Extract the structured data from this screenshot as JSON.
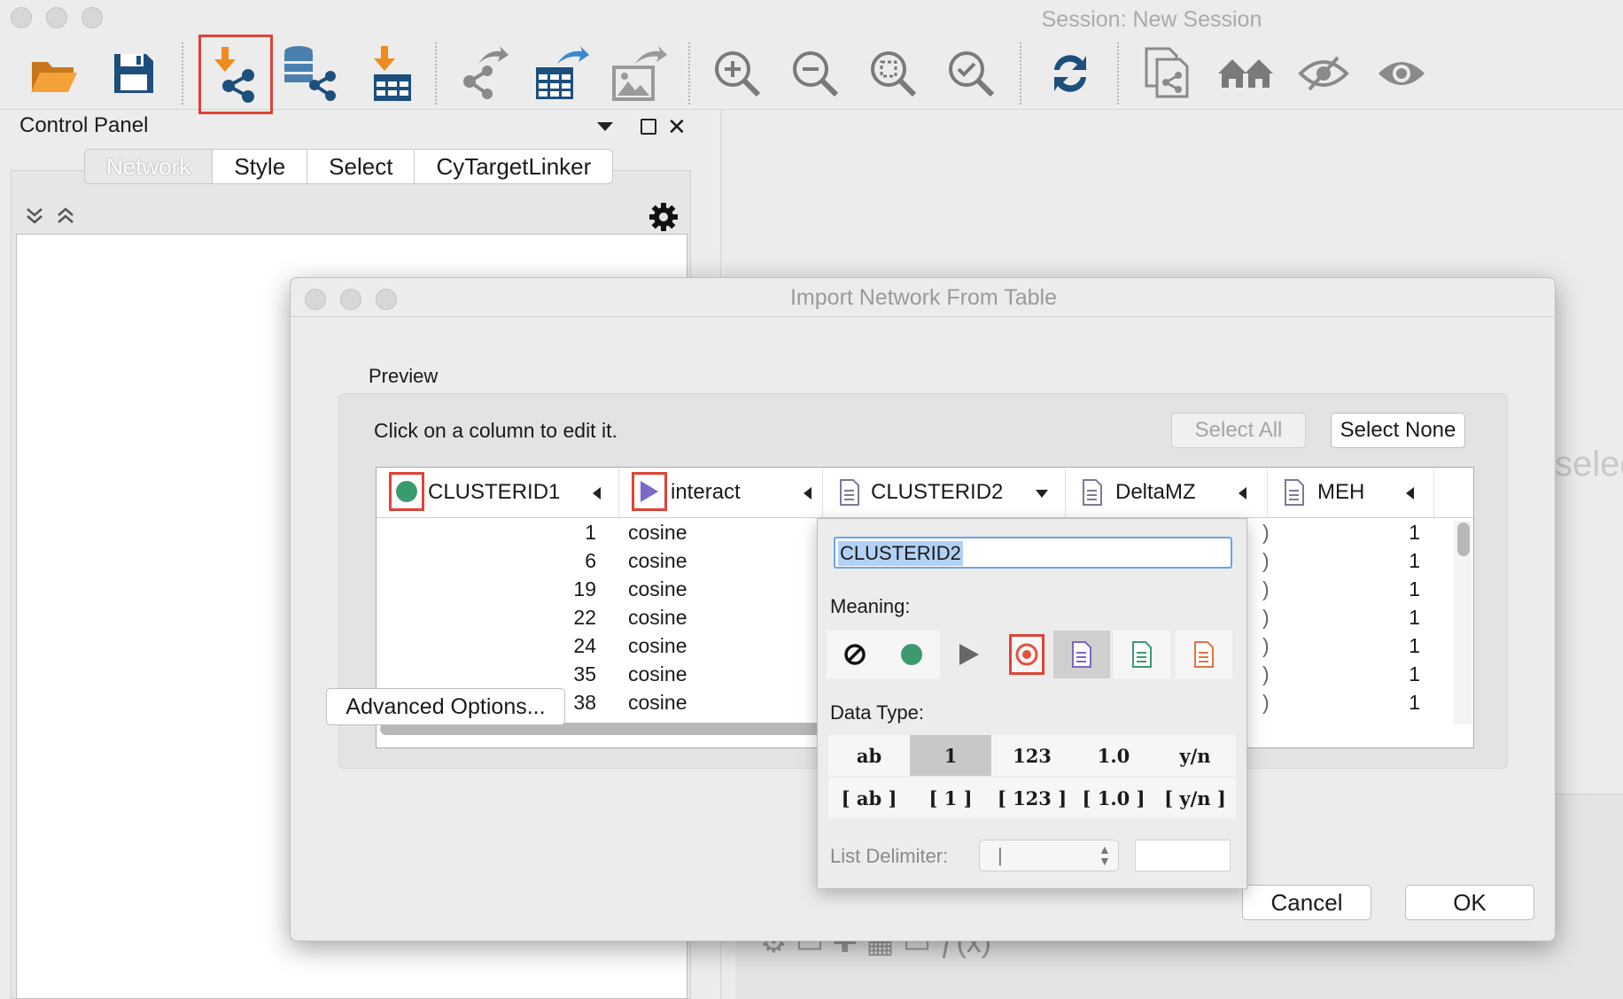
{
  "window": {
    "title": "Session: New Session"
  },
  "toolbar": {
    "icons": [
      "open-folder-icon",
      "save-icon",
      "import-network-from-file-icon",
      "import-network-from-database-icon",
      "import-table-icon",
      "export-network-icon",
      "export-table-icon",
      "export-image-icon",
      "zoom-in-icon",
      "zoom-out-icon",
      "zoom-fit-icon",
      "zoom-selected-icon",
      "refresh-icon",
      "new-network-from-selection-icon",
      "home-icon",
      "hide-icon",
      "show-icon"
    ]
  },
  "control_panel": {
    "title": "Control Panel",
    "tabs": [
      "Network",
      "Style",
      "Select",
      "CyTargetLinker"
    ]
  },
  "background": {
    "partial_text": "selec"
  },
  "dialog": {
    "title": "Import Network From Table",
    "preview_label": "Preview",
    "instruction": "Click on a column to edit it.",
    "select_all": "Select All",
    "select_none": "Select None",
    "advanced_options": "Advanced Options...",
    "cancel": "Cancel",
    "ok": "OK",
    "columns": [
      "CLUSTERID1",
      "interact",
      "CLUSTERID2",
      "DeltaMZ",
      "MEH"
    ],
    "rows": [
      {
        "id": "1",
        "interact": "cosine",
        "meh": "1"
      },
      {
        "id": "6",
        "interact": "cosine",
        "meh": "1"
      },
      {
        "id": "19",
        "interact": "cosine",
        "meh": "1"
      },
      {
        "id": "22",
        "interact": "cosine",
        "meh": "1"
      },
      {
        "id": "24",
        "interact": "cosine",
        "meh": "1"
      },
      {
        "id": "35",
        "interact": "cosine",
        "meh": "1"
      },
      {
        "id": "38",
        "interact": "cosine",
        "meh": "1"
      }
    ]
  },
  "column_editor": {
    "name_value": "CLUSTERID2",
    "meaning_label": "Meaning:",
    "data_type_label": "Data Type:",
    "data_types_row1": [
      "ab",
      "1",
      "123",
      "1.0",
      "y/n"
    ],
    "data_types_row2": [
      "[ ab ]",
      "[ 1 ]",
      "[ 123 ]",
      "[ 1.0 ]",
      "[ y/n ]"
    ],
    "selected_data_type": "1",
    "list_delimiter_label": "List Delimiter:",
    "list_delimiter_value": "|"
  },
  "colors": {
    "highlight": "#e04236",
    "source_node": "#3c9a6f",
    "interaction": "#7b68c8",
    "target_node": "#e2533c",
    "blue_icon": "#1d4f7c",
    "orange_icon": "#f08a1c"
  }
}
